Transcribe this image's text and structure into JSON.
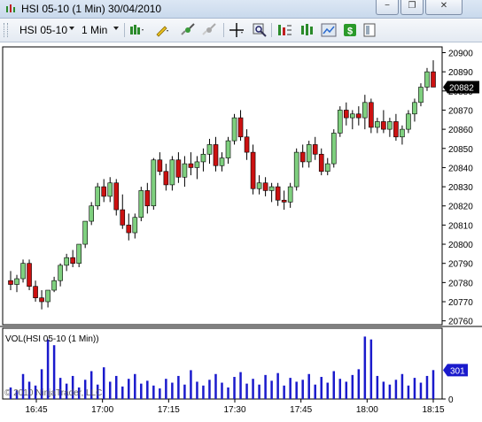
{
  "window": {
    "title": "HSI 05-10 (1 Min)  30/04/2010",
    "minimize_label": "−",
    "restore_label": "❐",
    "close_label": "✕"
  },
  "toolbar": {
    "instrument": "HSI 05-10",
    "interval": "1 Min",
    "icons": [
      "bar-type-icon",
      "drawing-pencil-icon",
      "zoom-in-icon",
      "zoom-out-icon",
      "crosshair-icon",
      "magnifier-icon",
      "strategies-icon",
      "indicators-icon",
      "chart-properties-icon",
      "dollar-icon",
      "data-box-icon"
    ]
  },
  "colors": {
    "up_candle": "#7fd07f",
    "down_candle": "#cc1111",
    "volume_bar": "#1a1acc",
    "price_marker": "#000000",
    "volume_marker": "#1a1acc"
  },
  "chart_data": [
    {
      "type": "candlestick",
      "series": [
        {
          "name": "HSI 05-10 (1 Min)"
        }
      ],
      "yticks": [
        20760,
        20770,
        20780,
        20790,
        20800,
        20810,
        20820,
        20830,
        20840,
        20850,
        20860,
        20870,
        20880,
        20890,
        20900
      ],
      "ylim": [
        20758,
        20903
      ],
      "xticks": [
        "16:45",
        "17:00",
        "17:15",
        "17:30",
        "17:45",
        "18:00",
        "18:15"
      ],
      "last_price": "20882",
      "candles_ohlc": [
        [
          20781,
          20786,
          20776,
          20779
        ],
        [
          20779,
          20784,
          20775,
          20782
        ],
        [
          20782,
          20792,
          20780,
          20790
        ],
        [
          20790,
          20792,
          20776,
          20778
        ],
        [
          20778,
          20781,
          20770,
          20772
        ],
        [
          20772,
          20776,
          20766,
          20770
        ],
        [
          20770,
          20772,
          20767,
          20776
        ],
        [
          20776,
          20783,
          20775,
          20781
        ],
        [
          20781,
          20790,
          20778,
          20789
        ],
        [
          20789,
          20795,
          20786,
          20793
        ],
        [
          20793,
          20797,
          20788,
          20790
        ],
        [
          20790,
          20800,
          20788,
          20800
        ],
        [
          20800,
          20812,
          20798,
          20812
        ],
        [
          20812,
          20822,
          20810,
          20820
        ],
        [
          20820,
          20832,
          20818,
          20830
        ],
        [
          20830,
          20834,
          20822,
          20825
        ],
        [
          20825,
          20835,
          20822,
          20832
        ],
        [
          20832,
          20834,
          20815,
          20818
        ],
        [
          20818,
          20826,
          20808,
          20810
        ],
        [
          20810,
          20816,
          20802,
          20806
        ],
        [
          20806,
          20816,
          20803,
          20814
        ],
        [
          20814,
          20830,
          20812,
          20828
        ],
        [
          20828,
          20832,
          20816,
          20820
        ],
        [
          20820,
          20845,
          20818,
          20844
        ],
        [
          20844,
          20848,
          20836,
          20838
        ],
        [
          20838,
          20842,
          20828,
          20831
        ],
        [
          20831,
          20846,
          20828,
          20844
        ],
        [
          20844,
          20848,
          20832,
          20835
        ],
        [
          20835,
          20846,
          20830,
          20842
        ],
        [
          20842,
          20848,
          20836,
          20840
        ],
        [
          20840,
          20846,
          20834,
          20843
        ],
        [
          20843,
          20850,
          20838,
          20847
        ],
        [
          20847,
          20855,
          20842,
          20852
        ],
        [
          20852,
          20856,
          20838,
          20841
        ],
        [
          20841,
          20848,
          20838,
          20845
        ],
        [
          20845,
          20856,
          20842,
          20854
        ],
        [
          20854,
          20868,
          20852,
          20866
        ],
        [
          20866,
          20870,
          20854,
          20856
        ],
        [
          20856,
          20860,
          20844,
          20848
        ],
        [
          20848,
          20852,
          20826,
          20829
        ],
        [
          20829,
          20836,
          20826,
          20832
        ],
        [
          20832,
          20835,
          20825,
          20828
        ],
        [
          20828,
          20832,
          20822,
          20830
        ],
        [
          20830,
          20832,
          20820,
          20823
        ],
        [
          20823,
          20828,
          20818,
          20822
        ],
        [
          20822,
          20832,
          20819,
          20830
        ],
        [
          20830,
          20850,
          20828,
          20848
        ],
        [
          20848,
          20852,
          20840,
          20843
        ],
        [
          20843,
          20854,
          20840,
          20852
        ],
        [
          20852,
          20856,
          20844,
          20847
        ],
        [
          20847,
          20850,
          20836,
          20838
        ],
        [
          20838,
          20845,
          20836,
          20842
        ],
        [
          20842,
          20860,
          20840,
          20858
        ],
        [
          20858,
          20872,
          20856,
          20870
        ],
        [
          20870,
          20874,
          20862,
          20866
        ],
        [
          20866,
          20870,
          20860,
          20868
        ],
        [
          20868,
          20872,
          20862,
          20866
        ],
        [
          20866,
          20878,
          20860,
          20874
        ],
        [
          20874,
          20876,
          20858,
          20861
        ],
        [
          20861,
          20866,
          20858,
          20864
        ],
        [
          20864,
          20870,
          20858,
          20860
        ],
        [
          20860,
          20866,
          20856,
          20864
        ],
        [
          20864,
          20868,
          20854,
          20856
        ],
        [
          20856,
          20862,
          20852,
          20860
        ],
        [
          20860,
          20870,
          20858,
          20868
        ],
        [
          20868,
          20876,
          20864,
          20874
        ],
        [
          20874,
          20884,
          20872,
          20882
        ],
        [
          20882,
          20892,
          20880,
          20890
        ],
        [
          20890,
          20896,
          20884,
          20882
        ]
      ]
    },
    {
      "type": "bar",
      "series": [
        {
          "name": "VOL(HSI 05-10 (1 Min))"
        }
      ],
      "ylim": [
        0,
        700
      ],
      "yticks": [
        0
      ],
      "last_value": "301",
      "values": [
        120,
        90,
        260,
        180,
        140,
        310,
        620,
        560,
        220,
        160,
        240,
        120,
        200,
        290,
        150,
        330,
        180,
        240,
        130,
        210,
        260,
        160,
        190,
        140,
        110,
        210,
        170,
        240,
        150,
        300,
        180,
        140,
        200,
        260,
        170,
        120,
        230,
        280,
        160,
        210,
        150,
        250,
        190,
        270,
        140,
        220,
        180,
        200,
        260,
        150,
        230,
        170,
        290,
        210,
        180,
        250,
        310,
        650,
        620,
        240,
        180,
        150,
        200,
        260,
        140,
        220,
        170,
        240,
        301
      ],
      "annotation": "© 2010 NinjaTrader, LLC"
    }
  ]
}
